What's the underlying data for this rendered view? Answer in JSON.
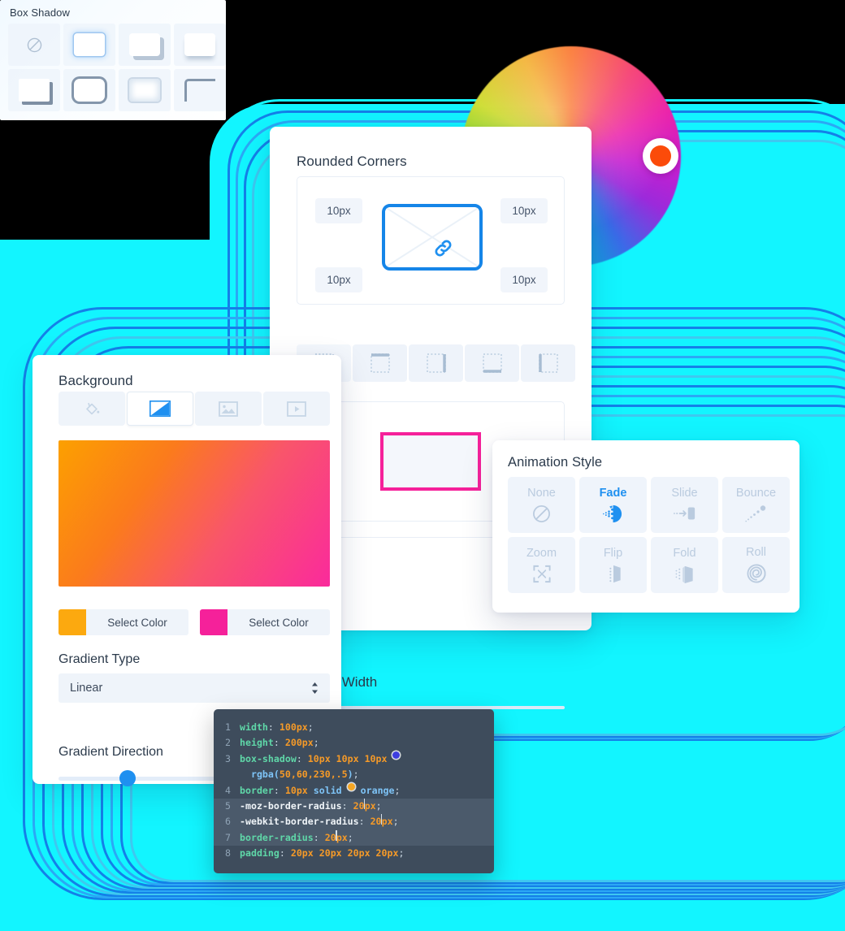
{
  "background_decor": {
    "cyan": "#12F5FF",
    "ring_blue": "#1480E8",
    "ring_blue_light": "#2BA8F5"
  },
  "color_wheel": {
    "name": "color-wheel",
    "knob_color": "#FB4B0A"
  },
  "rounded_panel": {
    "title": "Rounded Corners",
    "corner_values": [
      "10px",
      "10px",
      "10px",
      "10px"
    ],
    "center_icon": "link-icon",
    "border_side_icons": [
      "border-all-icon",
      "border-top-icon",
      "border-right-icon",
      "border-bottom-icon",
      "border-left-icon"
    ],
    "preview_border_color": "#F5219A",
    "border_width_label": "Border Width",
    "border_width_label_visible": "dth"
  },
  "background_panel": {
    "title": "Background",
    "tabs": [
      {
        "name": "fill-color",
        "icon": "paint-bucket-icon",
        "selected": false
      },
      {
        "name": "gradient",
        "icon": "gradient-icon",
        "selected": true
      },
      {
        "name": "image",
        "icon": "image-icon",
        "selected": false
      },
      {
        "name": "video",
        "icon": "video-icon",
        "selected": false
      }
    ],
    "gradient_preview": {
      "from": "#FCA000",
      "to": "#FA2A9C"
    },
    "color_stops": [
      {
        "swatch": "#FCA90F",
        "label": "Select Color"
      },
      {
        "swatch": "#F5219A",
        "label": "Select Color"
      }
    ],
    "gradient_type_label": "Gradient Type",
    "gradient_type_value": "Linear",
    "gradient_direction_label": "Gradient Direction",
    "gradient_direction_percent": 25
  },
  "animation_panel": {
    "title": "Animation Style",
    "selected": "Fade",
    "accent": "#1F90F0",
    "items": [
      {
        "label": "None",
        "icon": "no-entry-icon",
        "selected": false
      },
      {
        "label": "Fade",
        "icon": "fade-icon",
        "selected": true
      },
      {
        "label": "Slide",
        "icon": "slide-icon",
        "selected": false
      },
      {
        "label": "Bounce",
        "icon": "bounce-icon",
        "selected": false
      },
      {
        "label": "Zoom",
        "icon": "zoom-expand-icon",
        "selected": false
      },
      {
        "label": "Flip",
        "icon": "flip-icon",
        "selected": false
      },
      {
        "label": "Fold",
        "icon": "fold-icon",
        "selected": false
      },
      {
        "label": "Roll",
        "icon": "roll-spiral-icon",
        "selected": false
      }
    ]
  },
  "box_shadow_panel": {
    "title": "Box Shadow",
    "options": [
      "none",
      "glow-blue",
      "offset-hard",
      "drop-bottom",
      "offset-bottom-right",
      "outline-thick",
      "inner-shadow",
      "corner-top-left"
    ]
  },
  "code_editor": {
    "lines": [
      {
        "num": "1",
        "highlight": false,
        "tokens": [
          {
            "t": "prop",
            "v": "width"
          },
          {
            "t": "punc",
            "v": ": "
          },
          {
            "t": "val",
            "v": "100px"
          },
          {
            "t": "punc",
            "v": ";"
          }
        ]
      },
      {
        "num": "2",
        "highlight": false,
        "tokens": [
          {
            "t": "prop",
            "v": "height"
          },
          {
            "t": "punc",
            "v": ": "
          },
          {
            "t": "val",
            "v": "200px"
          },
          {
            "t": "punc",
            "v": ";"
          }
        ]
      },
      {
        "num": "3",
        "highlight": false,
        "tokens": [
          {
            "t": "prop",
            "v": "box-shadow"
          },
          {
            "t": "punc",
            "v": ": "
          },
          {
            "t": "val",
            "v": "10px 10px 10px "
          },
          {
            "t": "dot",
            "v": "blue"
          }
        ]
      },
      {
        "num": "",
        "highlight": false,
        "tokens": [
          {
            "t": "fn",
            "v": "  rgba("
          },
          {
            "t": "val",
            "v": "50,60,230,.5"
          },
          {
            "t": "fn",
            "v": ")"
          },
          {
            "t": "punc",
            "v": ";"
          }
        ]
      },
      {
        "num": "4",
        "highlight": false,
        "tokens": [
          {
            "t": "prop",
            "v": "border"
          },
          {
            "t": "punc",
            "v": ": "
          },
          {
            "t": "val",
            "v": "10px "
          },
          {
            "t": "kw",
            "v": "solid "
          },
          {
            "t": "dot",
            "v": "orange"
          },
          {
            "t": "kw",
            "v": " orange"
          },
          {
            "t": "punc",
            "v": ";"
          }
        ]
      },
      {
        "num": "5",
        "highlight": true,
        "tokens": [
          {
            "t": "propw",
            "v": "-moz-border-radius"
          },
          {
            "t": "punc",
            "v": ": "
          },
          {
            "t": "val",
            "v": "20"
          },
          {
            "t": "caret",
            "v": ""
          },
          {
            "t": "val",
            "v": "px"
          },
          {
            "t": "punc",
            "v": ";"
          }
        ]
      },
      {
        "num": "6",
        "highlight": true,
        "tokens": [
          {
            "t": "propw",
            "v": "-webkit-border-radius"
          },
          {
            "t": "punc",
            "v": ": "
          },
          {
            "t": "val",
            "v": "20"
          },
          {
            "t": "caret",
            "v": ""
          },
          {
            "t": "val",
            "v": "px"
          },
          {
            "t": "punc",
            "v": ";"
          }
        ]
      },
      {
        "num": "7",
        "highlight": true,
        "tokens": [
          {
            "t": "prop",
            "v": "border-radius"
          },
          {
            "t": "punc",
            "v": ": "
          },
          {
            "t": "val",
            "v": "20"
          },
          {
            "t": "caret",
            "v": ""
          },
          {
            "t": "val",
            "v": "px"
          },
          {
            "t": "punc",
            "v": ";"
          }
        ]
      },
      {
        "num": "8",
        "highlight": false,
        "tokens": [
          {
            "t": "prop",
            "v": "padding"
          },
          {
            "t": "punc",
            "v": ": "
          },
          {
            "t": "val",
            "v": "20px 20px 20px 20px"
          },
          {
            "t": "punc",
            "v": ";"
          }
        ]
      }
    ]
  }
}
